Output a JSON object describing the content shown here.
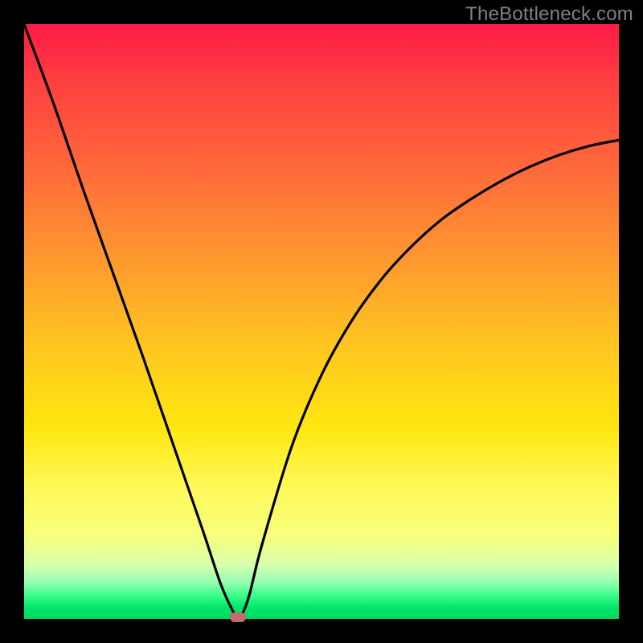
{
  "watermark": "TheBottleneck.com",
  "chart_data": {
    "type": "line",
    "title": "",
    "xlabel": "",
    "ylabel": "",
    "x_range": [
      0,
      100
    ],
    "y_range": [
      0,
      100
    ],
    "note": "Values estimated from pixels; x is horizontal position fraction, y is bottleneck percentage (0 = green/bottom, 100 = red/top).",
    "series": [
      {
        "name": "bottleneck-curve",
        "x": [
          0,
          5,
          10,
          15,
          20,
          25,
          30,
          33,
          35,
          36,
          37,
          38,
          40,
          45,
          50,
          55,
          60,
          65,
          70,
          75,
          80,
          85,
          90,
          95,
          100
        ],
        "y": [
          100,
          86.5,
          72,
          58,
          44,
          29.5,
          15,
          6,
          1.5,
          0,
          1.5,
          4.5,
          12.5,
          29,
          41,
          50,
          57,
          62.5,
          67,
          70.5,
          73.5,
          76,
          78,
          79.5,
          80.5
        ]
      }
    ],
    "marker": {
      "x": 36,
      "y": 0,
      "label": "optimal-point"
    },
    "background_gradient": {
      "top": "#ff1a46",
      "mid": "#ffe70f",
      "bottom": "#00d860"
    }
  }
}
